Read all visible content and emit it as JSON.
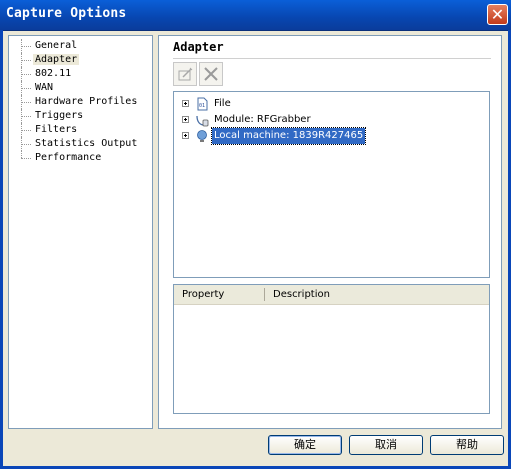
{
  "window": {
    "title": "Capture Options"
  },
  "nav": {
    "items": [
      {
        "label": "General",
        "selected": false
      },
      {
        "label": "Adapter",
        "selected": true
      },
      {
        "label": "802.11",
        "selected": false
      },
      {
        "label": "WAN",
        "selected": false
      },
      {
        "label": "Hardware Profiles",
        "selected": false
      },
      {
        "label": "Triggers",
        "selected": false
      },
      {
        "label": "Filters",
        "selected": false
      },
      {
        "label": "Statistics Output",
        "selected": false
      },
      {
        "label": "Performance",
        "selected": false
      }
    ]
  },
  "adapter": {
    "heading": "Adapter",
    "toolbar": {
      "edit_icon": "edit-icon",
      "delete_icon": "delete-icon"
    },
    "tree": [
      {
        "label": "File",
        "icon": "file-icon",
        "selected": false
      },
      {
        "label": "Module: RFGrabber",
        "icon": "module-icon",
        "selected": false
      },
      {
        "label": "Local machine: 1839R427465",
        "icon": "local-machine-icon",
        "selected": true
      }
    ],
    "properties": {
      "columns": [
        "Property",
        "Description"
      ]
    }
  },
  "buttons": {
    "ok": "确定",
    "cancel": "取消",
    "help": "帮助"
  },
  "colors": {
    "titlebar": "#0a5fd8",
    "selection": "#316ac5",
    "dialog_bg": "#ece9d8"
  }
}
